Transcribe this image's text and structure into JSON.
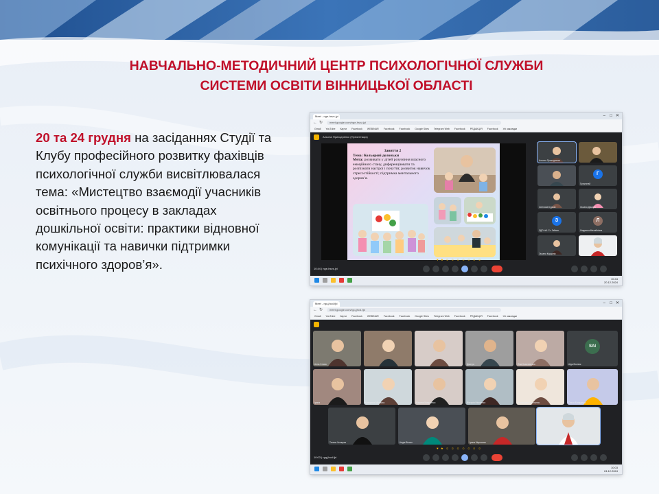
{
  "page": {
    "title_line1": "НАВЧАЛЬНО-МЕТОДИЧНИЙ ЦЕНТР  ПСИХОЛОГІЧНОЇ СЛУЖБИ",
    "title_line2": "СИСТЕМИ ОСВІТИ ВІННИЦЬКОЇ ОБЛАСТІ",
    "highlight": "20 та 24 грудня",
    "body": " на засіданнях Студії та Клубу професійного розвитку фахівців психологічної служби висвітлювалася тема: «Мистецтво взаємодії учасників освітнього процесу в закладах дошкільної освіти: практики відновної комунікації та навички підтримки психічного здоров’я»."
  },
  "colors": {
    "accent_red": "#c0102a",
    "meet_dark": "#202124",
    "tile_bg": "#3c4043",
    "end_call": "#ea4335",
    "slide_gradient": "#e3dcf5"
  },
  "screenshot1": {
    "tab_title": "Meet - nge-hsvz-jyi",
    "url": "meet.google.com/nge-hsvz-jyi",
    "bookmarks": [
      "Gmail",
      "YouTube",
      "Карти",
      "Facebook",
      "WEBINAR",
      "Facebook",
      "Facebook",
      "Google Sites",
      "Telegram Web",
      "Facebook",
      "РЕДАКЦІЯ",
      "Facebook",
      "Усі закладки"
    ],
    "presenter_label": "Альона Приходченко (Презентація)",
    "slide": {
      "heading": "Заняття 2",
      "topic_label": "Тема:",
      "topic": "Кольорові долоньки",
      "goal_label": "Мета:",
      "goal": "розвивати у дітей розуміння власного емоційного стану, диференціювати та розпізнати настрої і почуття; розвиток навичок стресостійкості; підтримка ментального здоров’я."
    },
    "participants": [
      {
        "name": "Альона Приходченко",
        "initial": "",
        "avatar_color": ""
      },
      {
        "name": "",
        "initial": "",
        "avatar_color": ""
      },
      {
        "name": "",
        "initial": "",
        "avatar_color": ""
      },
      {
        "name": "Гульнятай",
        "initial": "Г",
        "avatar_color": "#1a73e8"
      },
      {
        "name": "Світлана Бурлак",
        "initial": "",
        "avatar_color": ""
      },
      {
        "name": "Оксана Дмитра",
        "initial": "",
        "avatar_color": ""
      },
      {
        "name": "ЗДО №1 Ст. Гайсин",
        "initial": "З",
        "avatar_color": "#1a73e8"
      },
      {
        "name": "Людмила Михайлівна",
        "initial": "Л",
        "avatar_color": "#8d6e63"
      },
      {
        "name": "Оксана Кордонік",
        "initial": "",
        "avatar_color": ""
      },
      {
        "name": "",
        "initial": "",
        "avatar_color": ""
      }
    ],
    "meet_time": "10:44  |  nge-hsvz-jyi",
    "clock": "10:44",
    "date": "20.12.2024"
  },
  "screenshot2": {
    "tab_title": "Meet - rgq-jhcd-fjd",
    "url": "meet.google.com/rgq-jhcd-fjd",
    "bookmarks": [
      "Gmail",
      "YouTube",
      "Карти",
      "Facebook",
      "WEBINAR",
      "Facebook",
      "Facebook",
      "Google Sites",
      "Telegram Web",
      "Facebook",
      "РЕДАКЦІЯ",
      "Facebook",
      "Усі закладки"
    ],
    "participants": [
      {
        "name": "Анна Слива",
        "initial": "",
        "avatar_color": ""
      },
      {
        "name": "",
        "initial": "",
        "avatar_color": ""
      },
      {
        "name": "",
        "initial": "",
        "avatar_color": ""
      },
      {
        "name": "Дмитро",
        "initial": "",
        "avatar_color": ""
      },
      {
        "name": "Ліна Кохачевська",
        "initial": "",
        "avatar_color": ""
      },
      {
        "name": "Аїда Вознюк",
        "initial": "SAI",
        "avatar_color": "#3c6e4f"
      },
      {
        "name": "Ірина",
        "initial": "",
        "avatar_color": ""
      },
      {
        "name": "Катерина Абрамюк",
        "initial": "",
        "avatar_color": ""
      },
      {
        "name": "Марина Мазуренко",
        "initial": "",
        "avatar_color": ""
      },
      {
        "name": "Вікторія Ніконенко",
        "initial": "",
        "avatar_color": ""
      },
      {
        "name": "Валентина Хмельнюк",
        "initial": "",
        "avatar_color": ""
      },
      {
        "name": "Ольга Бондарчук",
        "initial": "",
        "avatar_color": ""
      },
      {
        "name": "Тетяна Ченюрак",
        "initial": "",
        "avatar_color": ""
      },
      {
        "name": "Надія Вілько",
        "initial": "",
        "avatar_color": ""
      },
      {
        "name": "Ірина Мартинюк",
        "initial": "",
        "avatar_color": ""
      },
      {
        "name": "",
        "initial": "",
        "avatar_color": ""
      }
    ],
    "meet_time": "10:03  |  rgq-jhcd-fjd",
    "clock": "10:03",
    "date": "24.12.2024"
  }
}
